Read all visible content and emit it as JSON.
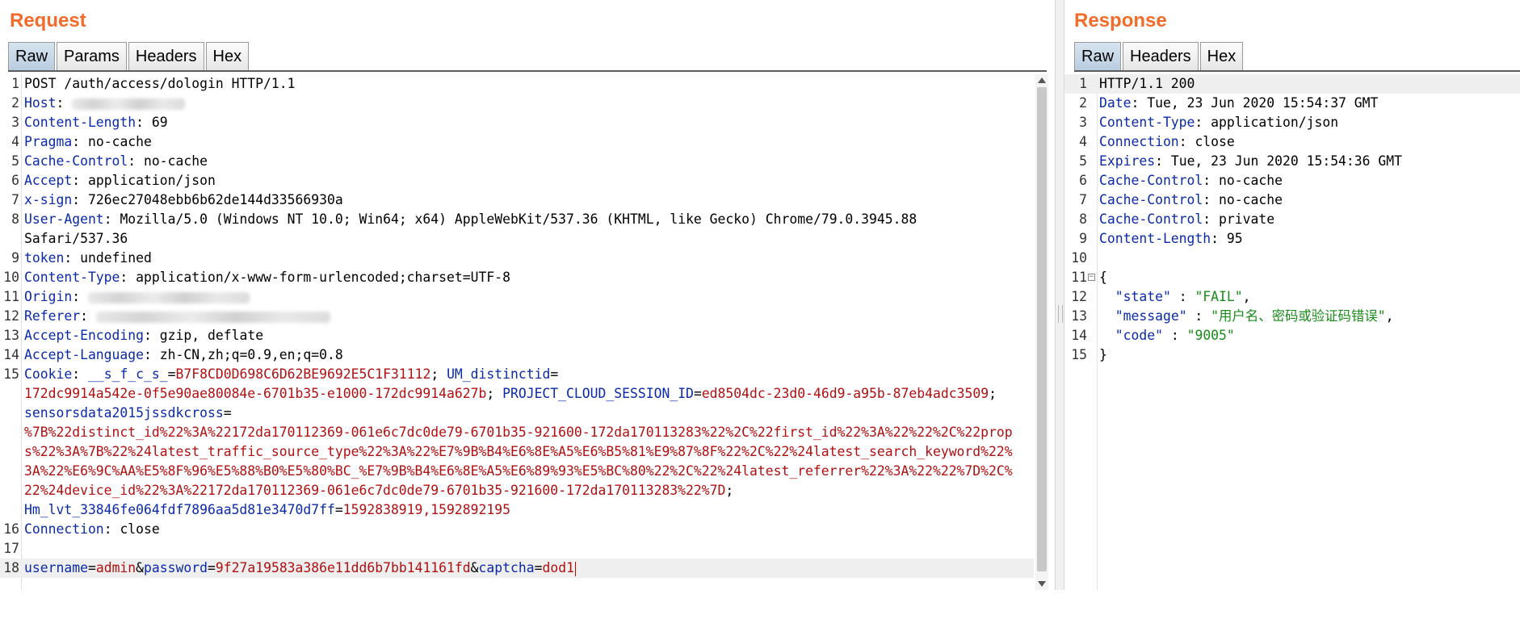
{
  "request": {
    "title": "Request",
    "tabs": [
      "Raw",
      "Params",
      "Headers",
      "Hex"
    ],
    "active_tab": "Raw",
    "lines": [
      {
        "n": "1",
        "text": "POST /auth/access/dologin HTTP/1.1"
      },
      {
        "n": "2",
        "key": "Host",
        "sep": ": "
      },
      {
        "n": "3",
        "key": "Content-Length",
        "sep": ": ",
        "value": "69"
      },
      {
        "n": "4",
        "key": "Pragma",
        "sep": ": ",
        "value": "no-cache"
      },
      {
        "n": "5",
        "key": "Cache-Control",
        "sep": ": ",
        "value": "no-cache"
      },
      {
        "n": "6",
        "key": "Accept",
        "sep": ": ",
        "value": "application/json"
      },
      {
        "n": "7",
        "key": "x-sign",
        "sep": ": ",
        "value": "726ec27048ebb6b62de144d33566930a"
      },
      {
        "n": "8",
        "key": "User-Agent",
        "sep": ": ",
        "value": "Mozilla/5.0 (Windows NT 10.0; Win64; x64) AppleWebKit/537.36 (KHTML, like Gecko) Chrome/79.0.3945.88"
      },
      {
        "n": "",
        "text": "Safari/537.36"
      },
      {
        "n": "9",
        "key": "token",
        "sep": ": ",
        "value": "undefined"
      },
      {
        "n": "10",
        "key": "Content-Type",
        "sep": ": ",
        "value": "application/x-www-form-urlencoded;charset=UTF-8"
      },
      {
        "n": "11",
        "key": "Origin",
        "sep": ": "
      },
      {
        "n": "12",
        "key": "Referer",
        "sep": ": "
      },
      {
        "n": "13",
        "key": "Accept-Encoding",
        "sep": ": ",
        "value": "gzip, deflate"
      },
      {
        "n": "14",
        "key": "Accept-Language",
        "sep": ": ",
        "value": "zh-CN,zh;q=0.9,en;q=0.8"
      }
    ],
    "cookie": {
      "n": "15",
      "key": "Cookie",
      "c1_name": "__s_f_c_s_",
      "c1_value": "B7F8CD0D698C6D62BE9692E5C1F31112",
      "c2_name": "UM_distinctid",
      "c2_value": "172dc9914a542e-0f5e90ae80084e-6701b35-e1000-172dc9914a627b",
      "c3_name": "PROJECT_CLOUD_SESSION_ID",
      "c3_value": "ed8504dc-23d0-46d9-a95b-87eb4adc3509",
      "c4_name": "sensorsdata2015jssdkcross",
      "c4_value_lines": [
        "%7B%22distinct_id%22%3A%22172da170112369-061e6c7dc0de79-6701b35-921600-172da170113283%22%2C%22first_id%22%3A%22%22%2C%22prop",
        "s%22%3A%7B%22%24latest_traffic_source_type%22%3A%22%E7%9B%B4%E6%8E%A5%E6%B5%81%E9%87%8F%22%2C%22%24latest_search_keyword%22%",
        "3A%22%E6%9C%AA%E5%8F%96%E5%88%B0%E5%80%BC_%E7%9B%B4%E6%8E%A5%E6%89%93%E5%BC%80%22%2C%22%24latest_referrer%22%3A%22%22%7D%2C%",
        "22%24device_id%22%3A%22172da170112369-061e6c7dc0de79-6701b35-921600-172da170113283%22%7D"
      ],
      "c5_name": "Hm_lvt_33846fe064fdf7896aa5d81e3470d7ff",
      "c5_value": "1592838919,1592892195"
    },
    "connection": {
      "n": "16",
      "key": "Connection",
      "value": "close"
    },
    "blank_n": "17",
    "body": {
      "n": "18",
      "p1_name": "username",
      "p1_value": "admin",
      "p2_name": "password",
      "p2_value": "9f27a19583a386e11dd6b7bb141161fd",
      "p3_name": "captcha",
      "p3_value": "dod1"
    }
  },
  "response": {
    "title": "Response",
    "tabs": [
      "Raw",
      "Headers",
      "Hex"
    ],
    "active_tab": "Raw",
    "headers": [
      {
        "n": "1",
        "text": "HTTP/1.1 200"
      },
      {
        "n": "2",
        "key": "Date",
        "value": "Tue, 23 Jun 2020 15:54:37 GMT"
      },
      {
        "n": "3",
        "key": "Content-Type",
        "value": "application/json"
      },
      {
        "n": "4",
        "key": "Connection",
        "value": "close"
      },
      {
        "n": "5",
        "key": "Expires",
        "value": "Tue, 23 Jun 2020 15:54:36 GMT"
      },
      {
        "n": "6",
        "key": "Cache-Control",
        "value": "no-cache"
      },
      {
        "n": "7",
        "key": "Cache-Control",
        "value": "no-cache"
      },
      {
        "n": "8",
        "key": "Cache-Control",
        "value": "private"
      },
      {
        "n": "9",
        "key": "Content-Length",
        "value": "95"
      }
    ],
    "blank_n": "10",
    "json_open": {
      "n": "11",
      "text": "{"
    },
    "json_lines": [
      {
        "n": "12",
        "key": "\"state\"",
        "value": "\"FAIL\"",
        "trail": ","
      },
      {
        "n": "13",
        "key": "\"message\"",
        "value": "\"用户名、密码或验证码错误\"",
        "trail": ","
      },
      {
        "n": "14",
        "key": "\"code\"",
        "value": "\"9005\"",
        "trail": ""
      }
    ],
    "json_close": {
      "n": "15",
      "text": "}"
    }
  }
}
